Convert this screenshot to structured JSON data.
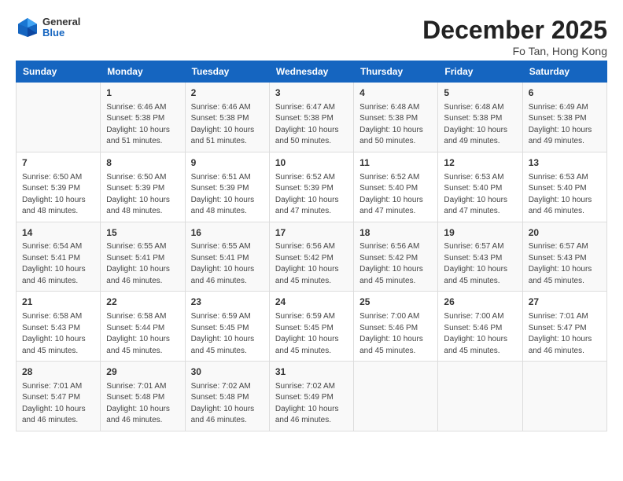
{
  "logo": {
    "general": "General",
    "blue": "Blue"
  },
  "title": "December 2025",
  "location": "Fo Tan, Hong Kong",
  "days_of_week": [
    "Sunday",
    "Monday",
    "Tuesday",
    "Wednesday",
    "Thursday",
    "Friday",
    "Saturday"
  ],
  "weeks": [
    [
      {
        "num": "",
        "info": ""
      },
      {
        "num": "1",
        "info": "Sunrise: 6:46 AM\nSunset: 5:38 PM\nDaylight: 10 hours\nand 51 minutes."
      },
      {
        "num": "2",
        "info": "Sunrise: 6:46 AM\nSunset: 5:38 PM\nDaylight: 10 hours\nand 51 minutes."
      },
      {
        "num": "3",
        "info": "Sunrise: 6:47 AM\nSunset: 5:38 PM\nDaylight: 10 hours\nand 50 minutes."
      },
      {
        "num": "4",
        "info": "Sunrise: 6:48 AM\nSunset: 5:38 PM\nDaylight: 10 hours\nand 50 minutes."
      },
      {
        "num": "5",
        "info": "Sunrise: 6:48 AM\nSunset: 5:38 PM\nDaylight: 10 hours\nand 49 minutes."
      },
      {
        "num": "6",
        "info": "Sunrise: 6:49 AM\nSunset: 5:38 PM\nDaylight: 10 hours\nand 49 minutes."
      }
    ],
    [
      {
        "num": "7",
        "info": "Sunrise: 6:50 AM\nSunset: 5:39 PM\nDaylight: 10 hours\nand 48 minutes."
      },
      {
        "num": "8",
        "info": "Sunrise: 6:50 AM\nSunset: 5:39 PM\nDaylight: 10 hours\nand 48 minutes."
      },
      {
        "num": "9",
        "info": "Sunrise: 6:51 AM\nSunset: 5:39 PM\nDaylight: 10 hours\nand 48 minutes."
      },
      {
        "num": "10",
        "info": "Sunrise: 6:52 AM\nSunset: 5:39 PM\nDaylight: 10 hours\nand 47 minutes."
      },
      {
        "num": "11",
        "info": "Sunrise: 6:52 AM\nSunset: 5:40 PM\nDaylight: 10 hours\nand 47 minutes."
      },
      {
        "num": "12",
        "info": "Sunrise: 6:53 AM\nSunset: 5:40 PM\nDaylight: 10 hours\nand 47 minutes."
      },
      {
        "num": "13",
        "info": "Sunrise: 6:53 AM\nSunset: 5:40 PM\nDaylight: 10 hours\nand 46 minutes."
      }
    ],
    [
      {
        "num": "14",
        "info": "Sunrise: 6:54 AM\nSunset: 5:41 PM\nDaylight: 10 hours\nand 46 minutes."
      },
      {
        "num": "15",
        "info": "Sunrise: 6:55 AM\nSunset: 5:41 PM\nDaylight: 10 hours\nand 46 minutes."
      },
      {
        "num": "16",
        "info": "Sunrise: 6:55 AM\nSunset: 5:41 PM\nDaylight: 10 hours\nand 46 minutes."
      },
      {
        "num": "17",
        "info": "Sunrise: 6:56 AM\nSunset: 5:42 PM\nDaylight: 10 hours\nand 45 minutes."
      },
      {
        "num": "18",
        "info": "Sunrise: 6:56 AM\nSunset: 5:42 PM\nDaylight: 10 hours\nand 45 minutes."
      },
      {
        "num": "19",
        "info": "Sunrise: 6:57 AM\nSunset: 5:43 PM\nDaylight: 10 hours\nand 45 minutes."
      },
      {
        "num": "20",
        "info": "Sunrise: 6:57 AM\nSunset: 5:43 PM\nDaylight: 10 hours\nand 45 minutes."
      }
    ],
    [
      {
        "num": "21",
        "info": "Sunrise: 6:58 AM\nSunset: 5:43 PM\nDaylight: 10 hours\nand 45 minutes."
      },
      {
        "num": "22",
        "info": "Sunrise: 6:58 AM\nSunset: 5:44 PM\nDaylight: 10 hours\nand 45 minutes."
      },
      {
        "num": "23",
        "info": "Sunrise: 6:59 AM\nSunset: 5:45 PM\nDaylight: 10 hours\nand 45 minutes."
      },
      {
        "num": "24",
        "info": "Sunrise: 6:59 AM\nSunset: 5:45 PM\nDaylight: 10 hours\nand 45 minutes."
      },
      {
        "num": "25",
        "info": "Sunrise: 7:00 AM\nSunset: 5:46 PM\nDaylight: 10 hours\nand 45 minutes."
      },
      {
        "num": "26",
        "info": "Sunrise: 7:00 AM\nSunset: 5:46 PM\nDaylight: 10 hours\nand 45 minutes."
      },
      {
        "num": "27",
        "info": "Sunrise: 7:01 AM\nSunset: 5:47 PM\nDaylight: 10 hours\nand 46 minutes."
      }
    ],
    [
      {
        "num": "28",
        "info": "Sunrise: 7:01 AM\nSunset: 5:47 PM\nDaylight: 10 hours\nand 46 minutes."
      },
      {
        "num": "29",
        "info": "Sunrise: 7:01 AM\nSunset: 5:48 PM\nDaylight: 10 hours\nand 46 minutes."
      },
      {
        "num": "30",
        "info": "Sunrise: 7:02 AM\nSunset: 5:48 PM\nDaylight: 10 hours\nand 46 minutes."
      },
      {
        "num": "31",
        "info": "Sunrise: 7:02 AM\nSunset: 5:49 PM\nDaylight: 10 hours\nand 46 minutes."
      },
      {
        "num": "",
        "info": ""
      },
      {
        "num": "",
        "info": ""
      },
      {
        "num": "",
        "info": ""
      }
    ]
  ]
}
